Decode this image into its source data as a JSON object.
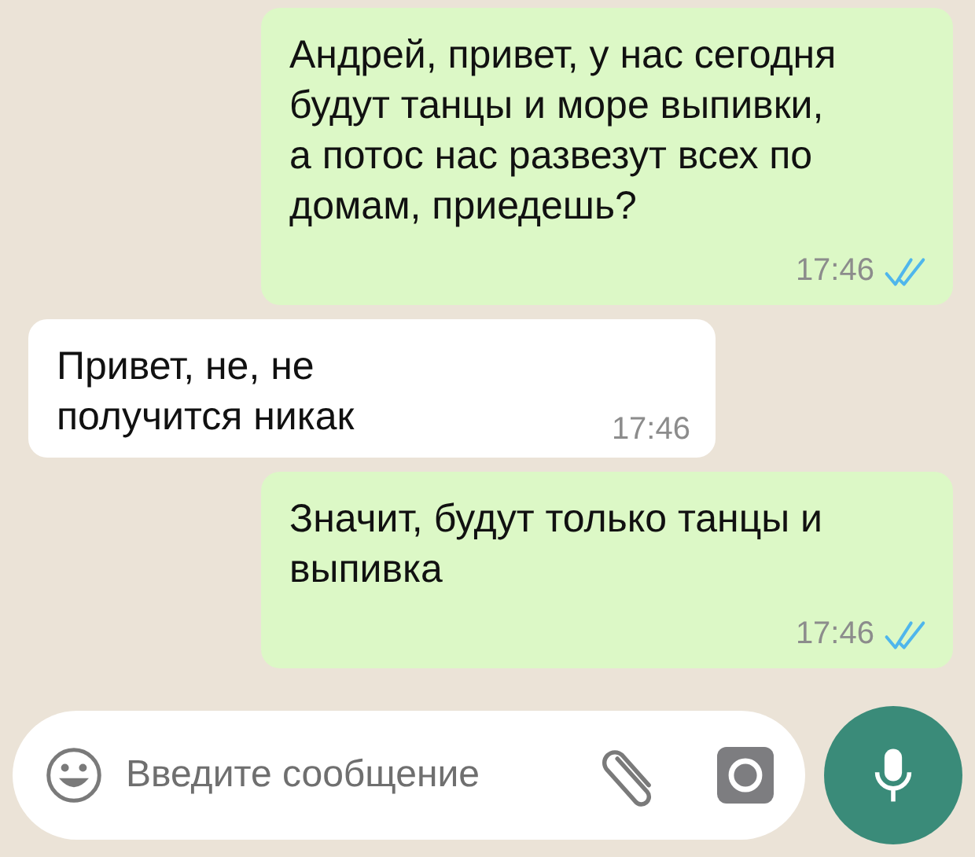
{
  "messages": [
    {
      "kind": "outgoing",
      "text": "Андрей, привет, у нас сегодня\nбудут танцы и море выпивки,\nа потос нас развезут всех по\nдомам, приедешь?",
      "time": "17:46",
      "read": true
    },
    {
      "kind": "incoming",
      "text": "Привет, не, не\nполучится никак",
      "time": "17:46"
    },
    {
      "kind": "outgoing",
      "text": "Значит, будут только танцы и\nвыпивка",
      "time": "17:46",
      "read": true
    }
  ],
  "composer": {
    "placeholder": "Введите сообщение"
  }
}
